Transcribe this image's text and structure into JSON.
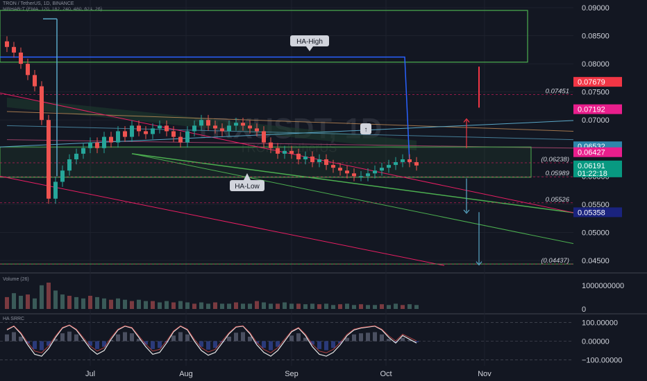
{
  "header": {
    "title": "TRON / TetherUS, 1D, BINANCE",
    "indicator": "MRHAB-T (EMA, 120, 182, 240, 480, 624, 26)"
  },
  "watermark": {
    "symbol": "TRXUSDT, 1D",
    "name": "TRON / TetherUS"
  },
  "colors": {
    "background": "#131722",
    "grid": "#1e222d",
    "up": "#26a69a",
    "down": "#ef5350",
    "green_line": "#4caf50",
    "blue_line": "#2962ff",
    "red_line": "#e91e63",
    "label_red": "#f23645",
    "label_pink": "#e91e8c",
    "label_blue": "#2962ff",
    "label_teal": "#2e86ab",
    "label_green": "#089981",
    "label_navy": "#1a237e"
  },
  "annotations": {
    "ha_high": "HA-High",
    "ha_low": "HA-Low"
  },
  "sub_panels": {
    "volume_title": "Volume (26)",
    "osc_title": "HA SRRC"
  },
  "chart_data": [
    {
      "type": "candlestick",
      "ylim": [
        0.0425,
        0.09
      ],
      "price_ticks": [
        "0.09000",
        "0.08500",
        "0.08000",
        "0.07500",
        "0.07000",
        "0.06500",
        "0.06000",
        "0.05500",
        "0.05000",
        "0.04500"
      ],
      "x_ticks": [
        "Jul",
        "Aug",
        "Sep",
        "Oct",
        "Nov"
      ],
      "price_labels": [
        {
          "text": "0.07679",
          "value": 0.07679,
          "color": "label_red"
        },
        {
          "text": "0.07192",
          "value": 0.07192,
          "color": "label_pink"
        },
        {
          "text": "0.06532",
          "value": 0.06532,
          "color": "label_teal"
        },
        {
          "text": "0.06427",
          "value": 0.06427,
          "color": "label_pink"
        },
        {
          "text": "0.06191",
          "value": 0.06191,
          "color": "label_green",
          "extra": "01:22:18"
        },
        {
          "text": "0.05358",
          "value": 0.05358,
          "color": "label_navy"
        }
      ],
      "level_texts": [
        {
          "text": "0.07451",
          "value": 0.07451
        },
        {
          "text": "0.05989",
          "value": 0.05989
        },
        {
          "text": "0.05526",
          "value": 0.05526
        },
        {
          "text": "(0.06238)",
          "value": 0.06238
        },
        {
          "text": "(0.04437)",
          "value": 0.04437
        }
      ],
      "closes": [
        0.083,
        0.082,
        0.08,
        0.078,
        0.076,
        0.07,
        0.056,
        0.059,
        0.061,
        0.063,
        0.064,
        0.065,
        0.066,
        0.065,
        0.067,
        0.066,
        0.068,
        0.067,
        0.069,
        0.068,
        0.0675,
        0.0685,
        0.069,
        0.068,
        0.067,
        0.066,
        0.068,
        0.069,
        0.07,
        0.069,
        0.0685,
        0.068,
        0.069,
        0.0695,
        0.069,
        0.0685,
        0.068,
        0.066,
        0.065,
        0.064,
        0.0645,
        0.064,
        0.063,
        0.0635,
        0.0625,
        0.063,
        0.062,
        0.0615,
        0.061,
        0.0605,
        0.06,
        0.06,
        0.0605,
        0.061,
        0.0615,
        0.062,
        0.0625,
        0.063,
        0.0625,
        0.0619
      ]
    },
    {
      "type": "bar",
      "name": "Volume",
      "yticks": [
        "1000000000",
        "0"
      ],
      "values": [
        0.45,
        0.6,
        0.5,
        0.55,
        0.4,
        0.9,
        1.0,
        0.7,
        0.55,
        0.5,
        0.45,
        0.4,
        0.5,
        0.45,
        0.4,
        0.35,
        0.4,
        0.35,
        0.3,
        0.35,
        0.3,
        0.3,
        0.25,
        0.3,
        0.25,
        0.3,
        0.25,
        0.2,
        0.25,
        0.2,
        0.25,
        0.2,
        0.2,
        0.25,
        0.2,
        0.2,
        0.3,
        0.25,
        0.2,
        0.2,
        0.25,
        0.2,
        0.2,
        0.18,
        0.2,
        0.18,
        0.2,
        0.15,
        0.18,
        0.2,
        0.15,
        0.18,
        0.15,
        0.15,
        0.18,
        0.15,
        0.2,
        0.15,
        0.18,
        0.15
      ]
    },
    {
      "type": "line",
      "name": "HA SRRC",
      "yticks": [
        "100.00000",
        "0.00000",
        "−100.00000"
      ],
      "ylim": [
        -120,
        120
      ],
      "values": [
        60,
        80,
        40,
        -20,
        -70,
        -80,
        -40,
        20,
        70,
        85,
        60,
        10,
        -40,
        -70,
        -50,
        10,
        60,
        80,
        70,
        20,
        -30,
        -70,
        -60,
        -10,
        50,
        80,
        60,
        0,
        -50,
        -75,
        -60,
        -10,
        40,
        75,
        80,
        40,
        -20,
        -60,
        -80,
        -50,
        0,
        50,
        70,
        30,
        -30,
        -70,
        -80,
        -60,
        -20,
        30,
        60,
        70,
        75,
        80,
        60,
        20,
        -10,
        30,
        10,
        -10
      ]
    }
  ]
}
